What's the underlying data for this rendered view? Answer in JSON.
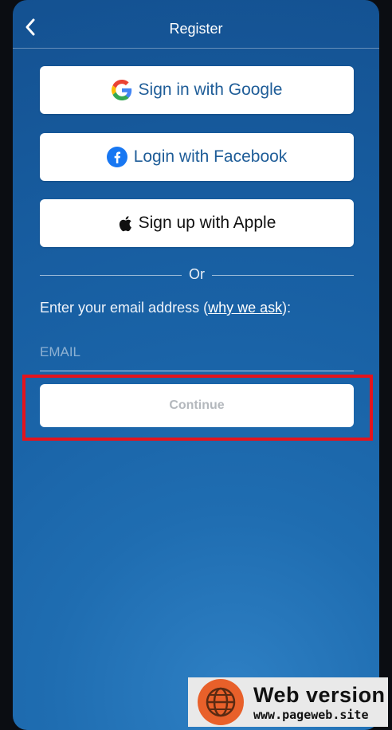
{
  "header": {
    "title": "Register",
    "back_icon": "chevron-left-icon"
  },
  "buttons": {
    "google": {
      "label": "Sign in with Google",
      "icon": "google-icon"
    },
    "facebook": {
      "label": "Login with Facebook",
      "icon": "facebook-icon"
    },
    "apple": {
      "label": "Sign up with Apple",
      "icon": "apple-icon"
    }
  },
  "divider": {
    "text": "Or"
  },
  "email_section": {
    "prompt_prefix": "Enter your email address (",
    "prompt_link": "why we ask",
    "prompt_suffix": "):",
    "placeholder": "EMAIL",
    "value": ""
  },
  "continue": {
    "label": "Continue"
  },
  "watermark": {
    "title": "Web version",
    "subtitle": "www.pageweb.site",
    "icon": "globe-icon"
  },
  "colors": {
    "background": "#1a64a8",
    "facebook_blue": "#1877f2",
    "button_text": "#1f5d98",
    "highlight_red": "#e3141d",
    "watermark_orange": "#e8602a"
  }
}
